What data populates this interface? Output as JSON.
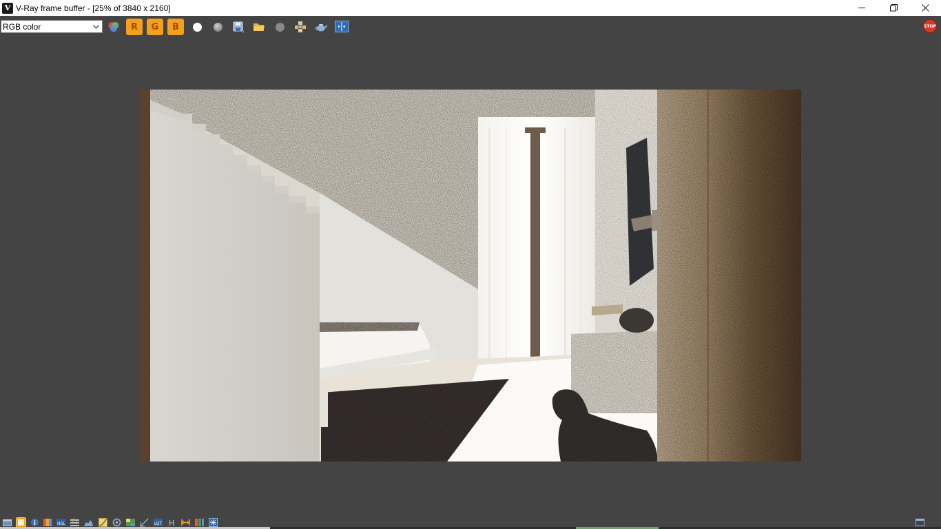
{
  "window": {
    "title": "V-Ray frame buffer - [25% of 3840 x 2160]",
    "logo_letter": "V",
    "controls": [
      "minimize-icon",
      "restore-icon",
      "close-icon"
    ]
  },
  "toolbar": {
    "channel": "RGB color",
    "channel_r": "R",
    "channel_g": "G",
    "channel_b": "B",
    "stop_label": "STOP",
    "icons": [
      "color-channels-icon",
      "red-channel-button",
      "green-channel-button",
      "blue-channel-button",
      "white-dot-icon",
      "gray-dot-icon",
      "save-icon",
      "open-folder-icon",
      "clear-icon",
      "region-render-icon",
      "teapot-icon",
      "compare-icon"
    ]
  },
  "render": {
    "scale_percent": 25,
    "resolution": "3840 x 2160"
  },
  "statusbar": {
    "icons": [
      "show-panel-icon",
      "history-icon",
      "info-icon",
      "lens-effects-icon",
      "hsl-icon",
      "levels-icon",
      "histogram-icon",
      "curves-icon",
      "white-balance-icon",
      "color-balance-icon",
      "exposure-icon",
      "lut-icon",
      "h-icon",
      "stereo-icon",
      "ocio-icon",
      "track-mouse-icon",
      "layout-icon"
    ],
    "progress": 0.7
  },
  "colors": {
    "background": "#444444",
    "accent_orange": "#f3a01c",
    "stop_red": "#d23a2c"
  }
}
